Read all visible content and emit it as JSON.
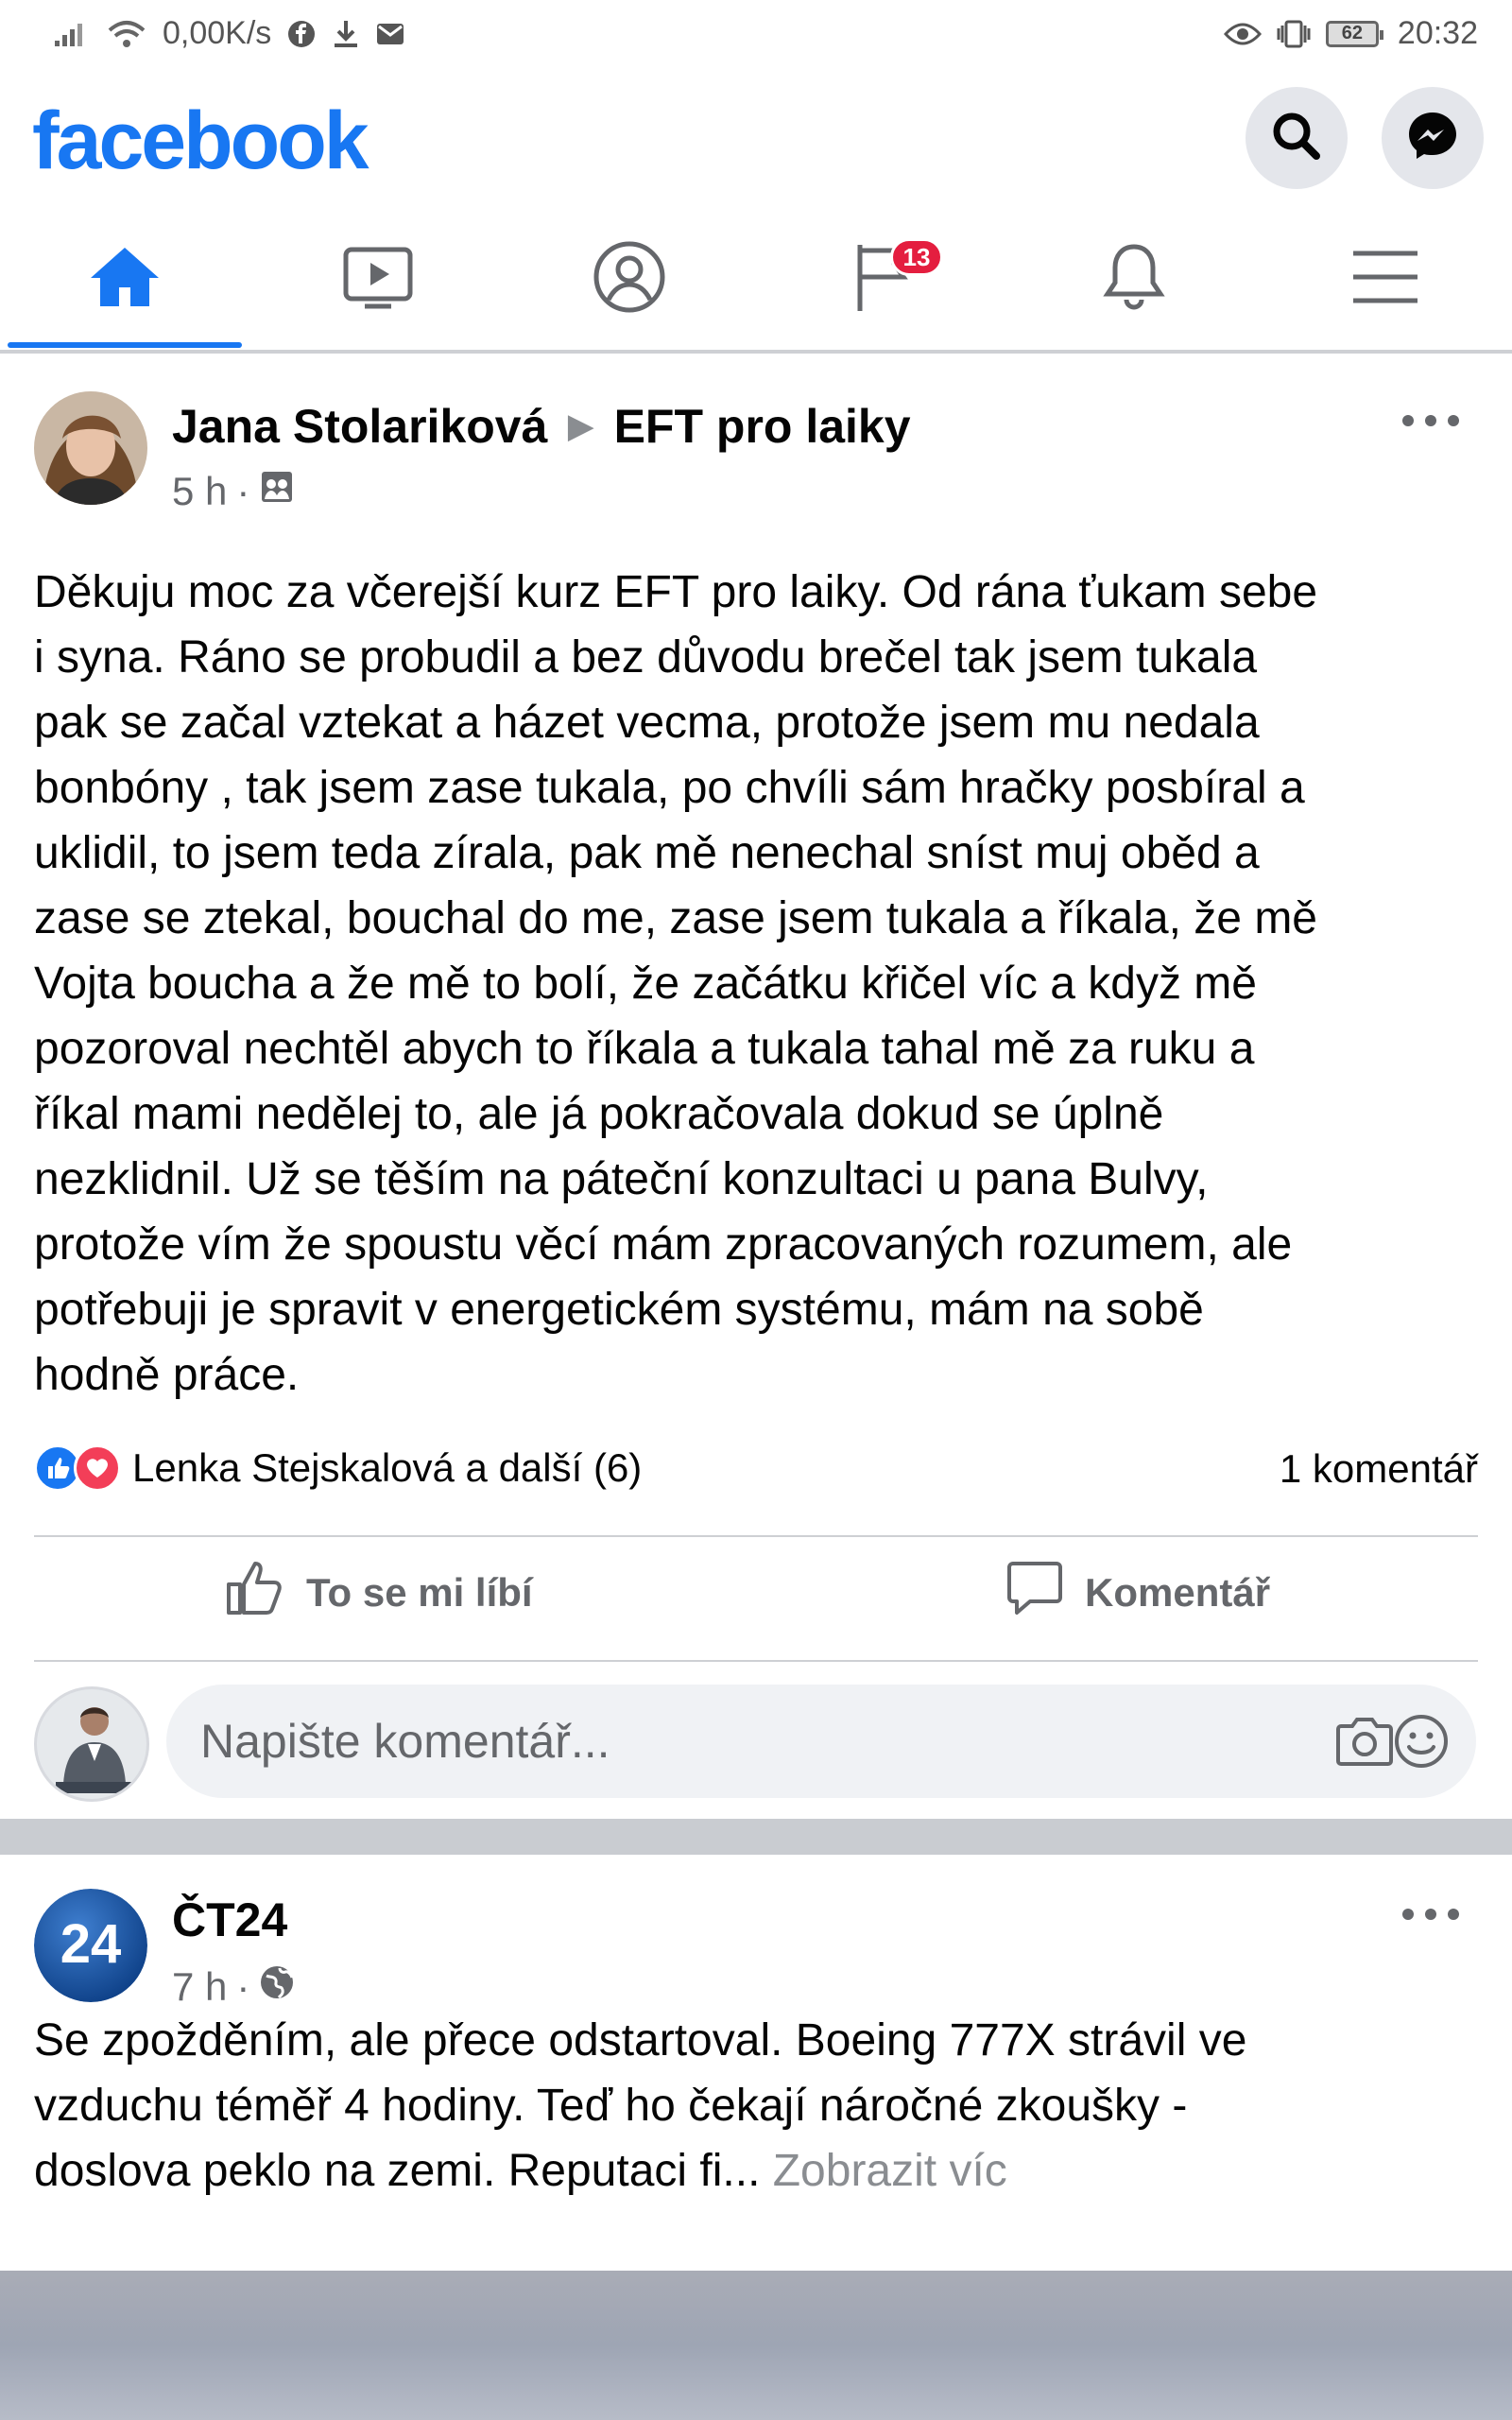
{
  "status_bar": {
    "network_speed": "0,00K/s",
    "battery": "62",
    "time": "20:32"
  },
  "header": {
    "logo": "facebook"
  },
  "nav": {
    "tabs": [
      {
        "name": "home",
        "icon": "home-icon",
        "active": true
      },
      {
        "name": "watch",
        "icon": "video-icon"
      },
      {
        "name": "profile",
        "icon": "profile-icon"
      },
      {
        "name": "pages",
        "icon": "flag-icon",
        "badge": "13"
      },
      {
        "name": "notifications",
        "icon": "bell-icon"
      },
      {
        "name": "menu",
        "icon": "menu-icon"
      }
    ]
  },
  "posts": [
    {
      "author": "Jana Stolariková",
      "group": "EFT pro laiky",
      "time": "5 h",
      "privacy_icon": "group-icon",
      "text": "Děkuju moc za včerejší kurz EFT pro laiky. Od rána ťukam sebe\ni syna. Ráno se probudil a bez důvodu brečel tak jsem tukala\npak se začal vztekat a házet vecma, protože jsem mu nedala\nbonbóny , tak jsem zase tukala, po chvíli sám hračky posbíral a\nuklidil, to jsem teda zírala, pak mě nenechal sníst muj oběd a\nzase se ztekal, bouchal do me, zase jsem tukala a říkala, že mě\nVojta boucha a že mě to bolí, že začátku křičel víc a když mě\npozoroval nechtěl abych to říkala a tukala tahal mě za ruku a\nříkal mami nedělej to, ale já pokračovala dokud se úplně\nnezklidnil. Už se těším na páteční konzultaci u pana Bulvy,\nprotože vím že spoustu věcí mám zpracovaných rozumem, ale\npotřebuji je spravit v energetickém systému, mám na sobě\nhodně práce.",
      "reactions": "Lenka Stejskalová a další (6)",
      "comments": "1 komentář",
      "like_label": "To se mi líbí",
      "comment_label": "Komentář",
      "comment_placeholder": "Napište komentář..."
    },
    {
      "author": "ČT24",
      "time": "7 h",
      "privacy_icon": "globe-icon",
      "avatar_text": "24",
      "text": "Se zpožděním, ale přece odstartoval. Boeing 777X strávil ve\nvzduchu téměř 4 hodiny. Teď ho čekají náročné zkoušky -\ndoslova peklo na zemi. Reputaci fi... ",
      "see_more": "Zobrazit víc"
    }
  ],
  "colors": {
    "brand": "#1877f2",
    "badge": "#e41e3f",
    "love": "#f33e58",
    "secondary_text": "#65676b"
  }
}
